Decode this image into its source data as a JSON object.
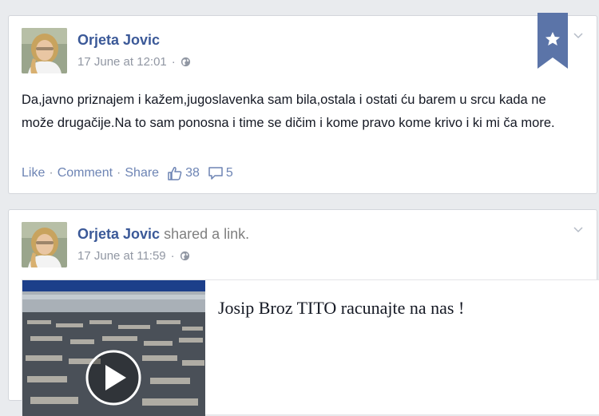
{
  "posts": [
    {
      "author": "Orjeta Jovic",
      "timestamp": "17 June at 12:01",
      "privacy_icon": "globe-icon",
      "text": "Da,javno priznajem i kažem,jugoslavenka sam bila,ostala i ostati ću barem u srcu kada ne može drugačije.Na to sam ponosna i time se dičim i kome pravo kome krivo i ki mi ča more.",
      "actions": {
        "like": "Like",
        "comment": "Comment",
        "share": "Share",
        "sep": "·"
      },
      "likes": "38",
      "comments": "5"
    },
    {
      "author": "Orjeta Jovic",
      "shared_prefix": "shared a",
      "shared_link": "link",
      "shared_suffix": ".",
      "timestamp": "17 June at 11:59",
      "privacy_icon": "globe-icon",
      "link_preview": {
        "title": "Josip Broz TITO racunajte na nas !"
      }
    }
  ],
  "colors": {
    "background": "#e9ebee",
    "name": "#3b5998",
    "action_link": "#6d84b4",
    "meta": "#9197a3",
    "bookmark": "#5b74a8"
  }
}
